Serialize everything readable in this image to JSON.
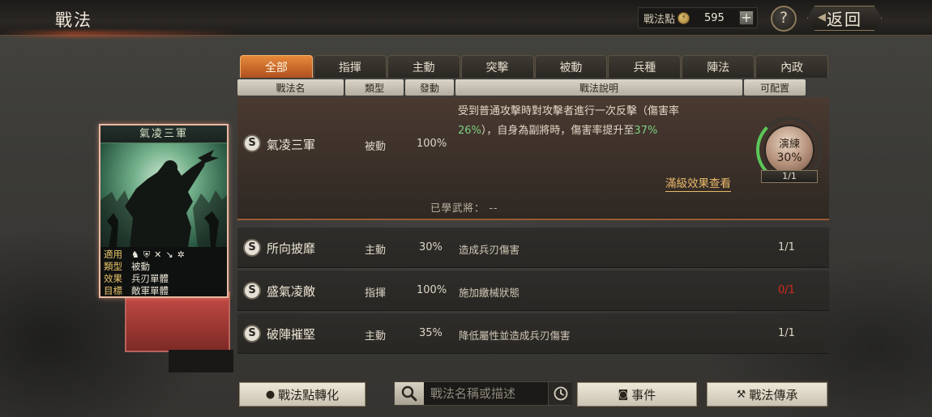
{
  "header": {
    "title": "戰法",
    "points_label": "戰法點",
    "points_value": "595",
    "add_label": "+",
    "help_label": "?",
    "back_label": "返回"
  },
  "tabs": [
    {
      "label": "全部",
      "active": true
    },
    {
      "label": "指揮",
      "active": false
    },
    {
      "label": "主動",
      "active": false
    },
    {
      "label": "突擊",
      "active": false
    },
    {
      "label": "被動",
      "active": false
    },
    {
      "label": "兵種",
      "active": false
    },
    {
      "label": "陣法",
      "active": false
    },
    {
      "label": "內政",
      "active": false
    }
  ],
  "columns": {
    "name": "戰法名",
    "type": "類型",
    "trigger": "發動",
    "desc": "戰法說明",
    "config": "可配置"
  },
  "selected": {
    "grade": "S",
    "name": "氣凌三軍",
    "type": "被動",
    "trigger": "100%",
    "desc_line1": "受到普通攻擊時對攻擊者進行一次反擊（傷害率",
    "desc_pct1": "26%",
    "desc_mid": "），自身為副將時，傷害率提升至",
    "desc_pct2": "37%",
    "effect_link": "滿級效果查看",
    "learned_label": "已學武將：",
    "learned_value": "--",
    "train_label": "演練",
    "train_pct": "30%",
    "train_progress": 0.3,
    "train_count": "1/1"
  },
  "rows": [
    {
      "grade": "S",
      "name": "所向披靡",
      "type": "主動",
      "trigger": "30%",
      "desc": "造成兵刃傷害",
      "config": "1/1",
      "config_red": false
    },
    {
      "grade": "S",
      "name": "盛氣凌敵",
      "type": "指揮",
      "trigger": "100%",
      "desc": "施加繳械狀態",
      "config": "0/1",
      "config_red": true
    },
    {
      "grade": "S",
      "name": "破陣摧堅",
      "type": "主動",
      "trigger": "35%",
      "desc": "降低屬性並造成兵刃傷害",
      "config": "1/1",
      "config_red": false
    }
  ],
  "card": {
    "title": "氣凌三軍",
    "apply_key": "適用",
    "type_key": "類型",
    "type_val": "被動",
    "effect_key": "效果",
    "effect_val": "兵刃單體",
    "target_key": "目標",
    "target_val": "敵軍單體"
  },
  "bottom": {
    "convert_label": "戰法點轉化",
    "search_placeholder": "戰法名稱或描述",
    "event_label": "事件",
    "inherit_label": "戰法傳承"
  },
  "colors": {
    "accent": "#d26a2c",
    "highlight_green": "#7ccf82",
    "warn_red": "#d8281e",
    "gold": "#e8b96a"
  }
}
